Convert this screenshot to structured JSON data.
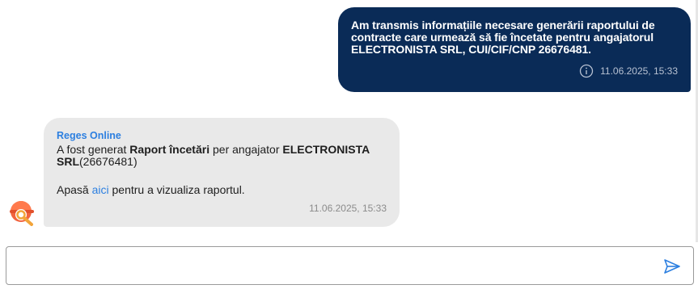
{
  "outgoing": {
    "text": "Am transmis informațiile necesare generării raportului de contracte care urmează să fie încetate pentru angajatorul ELECTRONISTA SRL, CUI/CIF/CNP 26676481.",
    "timestamp": "11.06.2025, 15:33",
    "icon": "info-icon",
    "bubble_color": "#0a2b57"
  },
  "incoming": {
    "sender": "Reges Online",
    "text_prefix": "A fost generat ",
    "report_name": "Raport încetări",
    "text_middle": " per angajator ",
    "employer": "ELECTRONISTA SRL",
    "cui": "(26676481)",
    "action_prefix": "Apasă ",
    "action_link": "aici",
    "action_suffix": " pentru a vizualiza raportul.",
    "timestamp": "11.06.2025, 15:33",
    "bubble_color": "#e9e9e9",
    "avatar_icon": "reges-bot-avatar-icon"
  },
  "composer": {
    "value": "",
    "placeholder": "",
    "send_icon": "send-icon",
    "accent": "#2c7fe0"
  }
}
